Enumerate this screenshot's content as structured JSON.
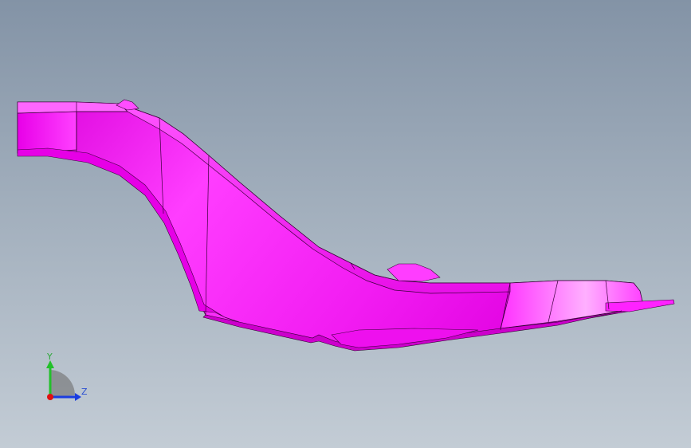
{
  "viewport": {
    "background_top": "#8393a6",
    "background_bottom": "#c3ccd5",
    "part_color": "#ff00ff"
  },
  "triad": {
    "y_label": "Y",
    "z_label": "Z",
    "y_color": "#22c02a",
    "z_color": "#1a3ce0",
    "x_color": "#e01010"
  }
}
